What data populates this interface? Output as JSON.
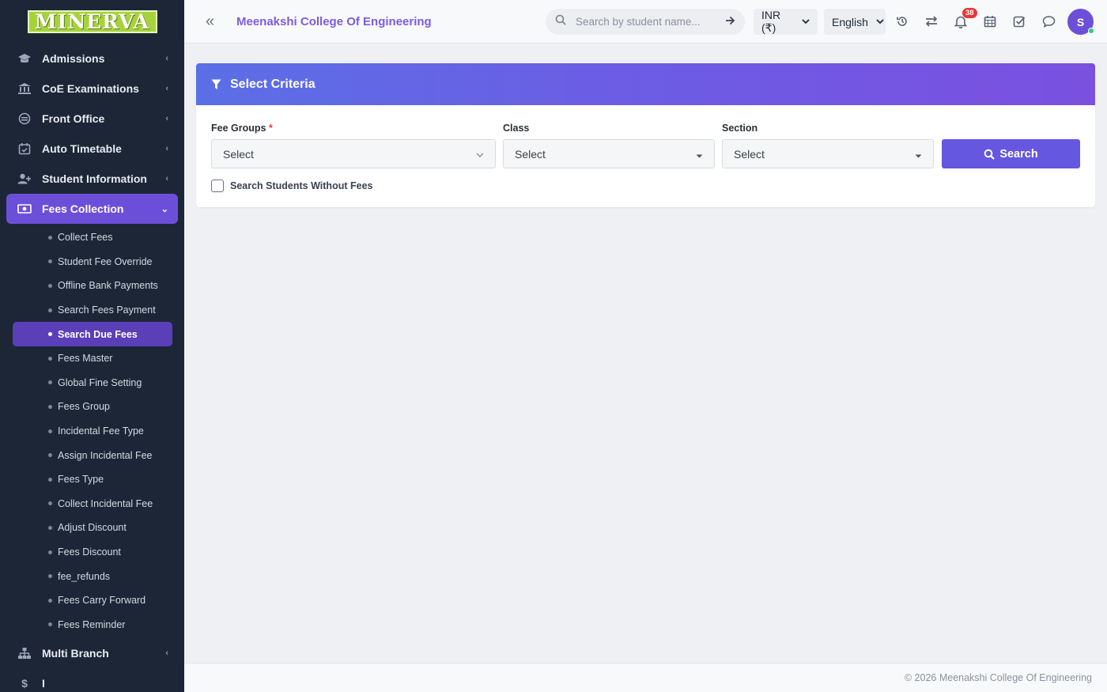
{
  "brand": {
    "logo_text": "MINERVA"
  },
  "sidebar": {
    "items": [
      {
        "label": "Admissions",
        "icon": "graduation-cap-icon"
      },
      {
        "label": "CoE Examinations",
        "icon": "bank-icon"
      },
      {
        "label": "Front Office",
        "icon": "reception-icon"
      },
      {
        "label": "Auto Timetable",
        "icon": "calendar-check-icon"
      },
      {
        "label": "Student Information",
        "icon": "user-plus-icon"
      },
      {
        "label": "Fees Collection",
        "icon": "money-icon",
        "active": true
      }
    ],
    "fees_sub": [
      "Collect Fees",
      "Student Fee Override",
      "Offline Bank Payments",
      "Search Fees Payment",
      "Search Due Fees",
      "Fees Master",
      "Global Fine Setting",
      "Fees Group",
      "Incidental Fee Type",
      "Assign Incidental Fee",
      "Fees Type",
      "Collect Incidental Fee",
      "Adjust Discount",
      "Fees Discount",
      "fee_refunds",
      "Fees Carry Forward",
      "Fees Reminder"
    ],
    "active_sub": "Search Due Fees",
    "after": [
      {
        "label": "Multi Branch",
        "icon": "sitemap-icon"
      },
      {
        "label": "I",
        "icon": "dollar-icon"
      }
    ]
  },
  "header": {
    "college": "Meenakshi College Of Engineering",
    "search_placeholder": "Search by student name...",
    "currency": "INR (₹)",
    "language": "English",
    "notifications_count": "38",
    "avatar_initial": "S"
  },
  "criteria": {
    "title": "Select Criteria",
    "fee_groups_label": "Fee Groups",
    "required_mark": "*",
    "fee_groups_value": "Select",
    "class_label": "Class",
    "class_value": "Select",
    "section_label": "Section",
    "section_value": "Select",
    "search_button": "Search",
    "without_fees_label": "Search Students Without Fees"
  },
  "footer": {
    "text": "© 2026 Meenakshi College Of Engineering"
  },
  "colors": {
    "accent": "#6c4fd9",
    "sidebar_bg": "#1c2637",
    "header_gradient_start": "#5b6fe6",
    "header_gradient_end": "#7a50df"
  }
}
